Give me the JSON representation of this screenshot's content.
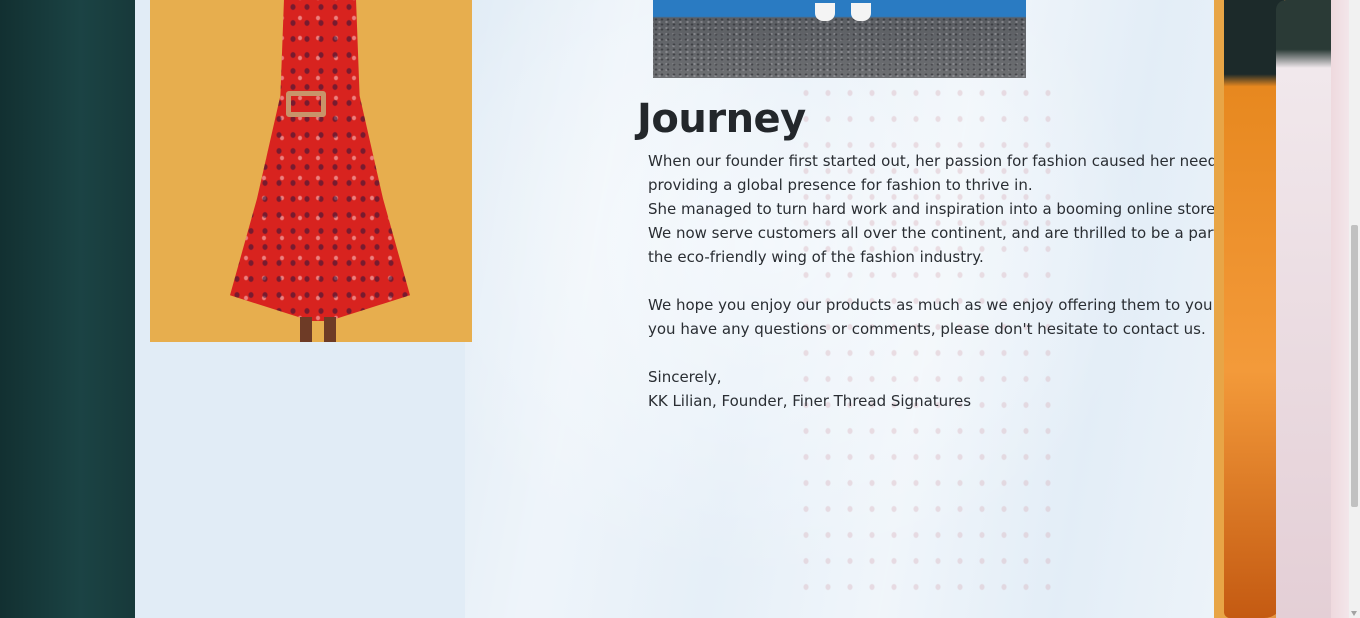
{
  "article": {
    "title": "Journey",
    "lines": [
      "When our founder first started out, her passion for fashion caused her need for",
      "providing a global presence for fashion to thrive in.",
      "She managed to turn hard work and inspiration into a booming online store.",
      "We now serve customers all over the continent, and are thrilled to be a part of",
      "the eco-friendly wing of the fashion industry.",
      "We hope you enjoy our products as much as we enjoy offering them to you. If",
      "you have any questions or comments, please don't hesitate to contact us.",
      "Sincerely,",
      "KK Lilian, Founder, Finer Thread Signatures"
    ]
  },
  "colors": {
    "panel": "#e1ecf6",
    "left_backdrop": "#16393a",
    "text": "#2a2e33",
    "title": "#23272b"
  },
  "images": {
    "left": "woman-in-red-dress-photo",
    "top": "street-sneakers-photo",
    "right_background": "clothing-rack-photo"
  }
}
